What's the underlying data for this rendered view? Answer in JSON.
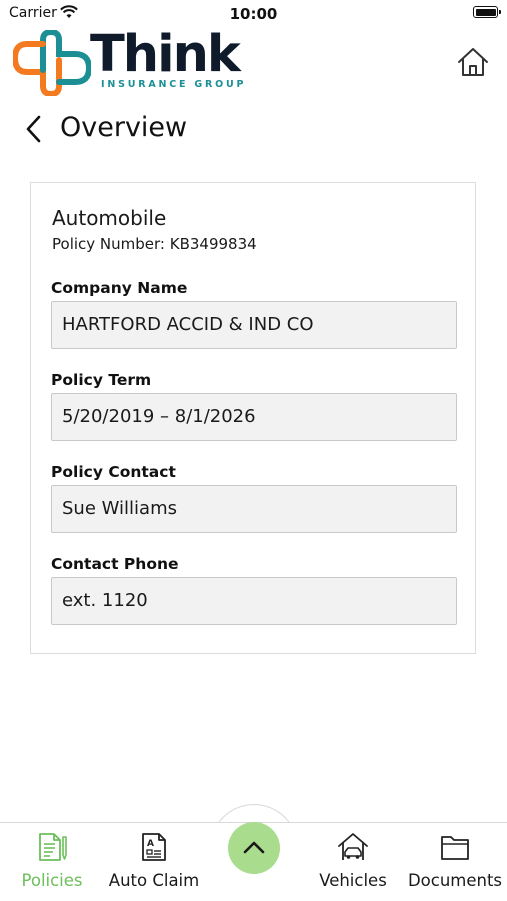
{
  "status_bar": {
    "carrier": "Carrier",
    "time": "10:00"
  },
  "header": {
    "brand_name": "Think",
    "brand_tagline": "INSURANCE GROUP"
  },
  "nav": {
    "title": "Overview"
  },
  "policy": {
    "type": "Automobile",
    "number_label": "Policy Number:",
    "number": "KB3499834",
    "fields": [
      {
        "label": "Company Name",
        "value": "HARTFORD ACCID & IND CO"
      },
      {
        "label": "Policy Term",
        "value": "5/20/2019 – 8/1/2026"
      },
      {
        "label": "Policy Contact",
        "value": "Sue Williams"
      },
      {
        "label": "Contact Phone",
        "value": "ext. 1120"
      }
    ]
  },
  "tabbar": {
    "tabs": [
      {
        "label": "Policies",
        "icon": "policies-icon",
        "active": true
      },
      {
        "label": "Auto Claim",
        "icon": "auto-claim-icon",
        "active": false
      },
      {
        "label": "Vehicles",
        "icon": "vehicles-icon",
        "active": false
      },
      {
        "label": "Documents",
        "icon": "documents-icon",
        "active": false
      }
    ],
    "center_button_icon": "chevron-up-icon"
  },
  "colors": {
    "accent_green": "#6cbf5c",
    "fab_green": "#a9dc8c",
    "logo_orange": "#f47a20",
    "logo_teal": "#1c8f95",
    "field_bg": "#f2f2f2"
  }
}
